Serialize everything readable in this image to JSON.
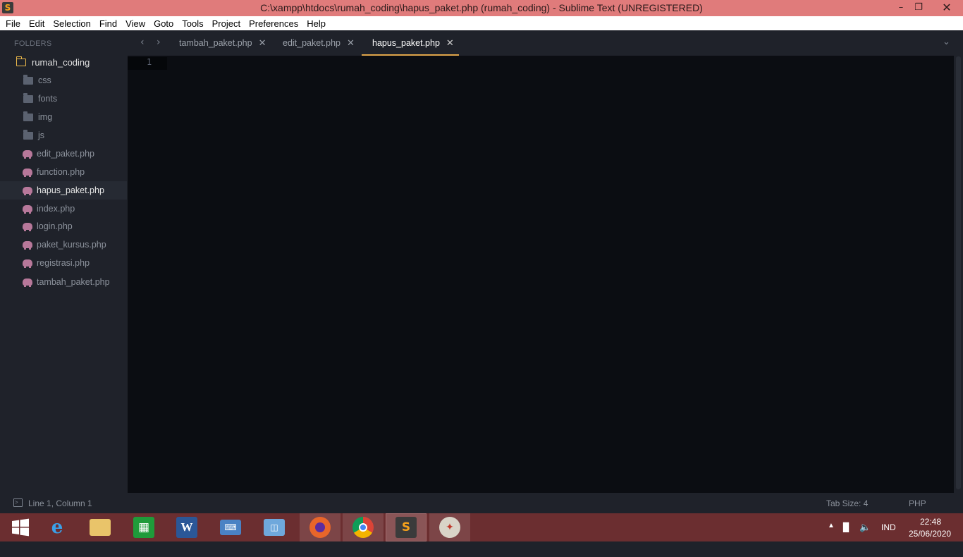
{
  "window": {
    "title": "C:\\xampp\\htdocs\\rumah_coding\\hapus_paket.php (rumah_coding) - Sublime Text (UNREGISTERED)",
    "controls": [
      "minimize-icon",
      "maximize-icon",
      "close-icon"
    ]
  },
  "menu": [
    {
      "label": "File"
    },
    {
      "label": "Edit"
    },
    {
      "label": "Selection"
    },
    {
      "label": "Find"
    },
    {
      "label": "View"
    },
    {
      "label": "Goto"
    },
    {
      "label": "Tools"
    },
    {
      "label": "Project"
    },
    {
      "label": "Preferences"
    },
    {
      "label": "Help"
    }
  ],
  "sidebar": {
    "header": "FOLDERS",
    "root": "rumah_coding",
    "folders": [
      "css",
      "fonts",
      "img",
      "js"
    ],
    "files": [
      {
        "name": "edit_paket.php",
        "active": false
      },
      {
        "name": "function.php",
        "active": false
      },
      {
        "name": "hapus_paket.php",
        "active": true
      },
      {
        "name": "index.php",
        "active": false
      },
      {
        "name": "login.php",
        "active": false
      },
      {
        "name": "paket_kursus.php",
        "active": false
      },
      {
        "name": "registrasi.php",
        "active": false
      },
      {
        "name": "tambah_paket.php",
        "active": false
      }
    ]
  },
  "tabs": [
    {
      "label": "tambah_paket.php",
      "active": false
    },
    {
      "label": "edit_paket.php",
      "active": false
    },
    {
      "label": "hapus_paket.php",
      "active": true
    }
  ],
  "editor": {
    "line_numbers": [
      "1"
    ]
  },
  "status": {
    "position": "Line 1, Column 1",
    "tab_size": "Tab Size: 4",
    "syntax": "PHP"
  },
  "taskbar": {
    "apps": [
      "windows-start-icon",
      "internet-explorer-icon",
      "file-explorer-icon",
      "store-icon",
      "word-icon",
      "remote-desktop-icon",
      "network-computer-icon",
      "firefox-icon",
      "chrome-icon",
      "sublime-text-icon",
      "paint-icon"
    ],
    "language": "IND",
    "time": "22:48",
    "date": "25/06/2020"
  },
  "colors": {
    "titlebar": "#e07b7b",
    "sidebar_bg": "#1f222a",
    "editor_bg": "#0b0d12",
    "tab_accent": "#e0a54a",
    "taskbar_bg": "#6b2e30"
  }
}
